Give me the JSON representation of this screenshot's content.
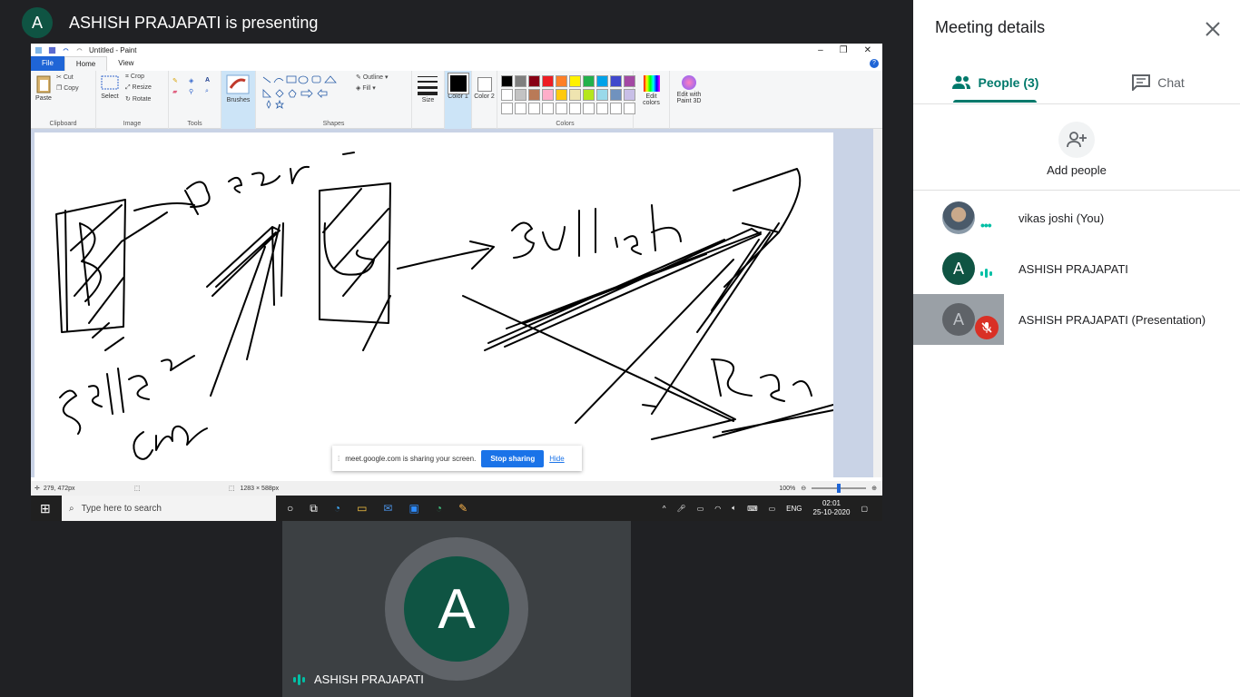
{
  "meeting": {
    "presenter_initial": "A",
    "presenter_banner": "ASHISH PRAJAPATI is presenting"
  },
  "paint": {
    "window_title": "Untitled - Paint",
    "tabs": [
      "File",
      "Home",
      "View"
    ],
    "clipboard": {
      "paste": "Paste",
      "cut": "Cut",
      "copy": "Copy",
      "group": "Clipboard"
    },
    "image": {
      "select": "Select",
      "crop": "Crop",
      "resize": "Resize",
      "rotate": "Rotate",
      "group": "Image"
    },
    "tools_group": "Tools",
    "brushes": "Brushes",
    "shapes": {
      "outline": "Outline",
      "fill": "Fill",
      "group": "Shapes"
    },
    "size": "Size",
    "color1": "Color 1",
    "color2": "Color 2",
    "colors_group": "Colors",
    "edit_colors": "Edit colors",
    "edit_3d": "Edit with Paint 3D",
    "palette_row1": [
      "#000000",
      "#7f7f7f",
      "#880015",
      "#ed1c24",
      "#ff7f27",
      "#fff200",
      "#22b14c",
      "#00a2e8",
      "#3f48cc",
      "#a349a4"
    ],
    "palette_row2": [
      "#ffffff",
      "#c3c3c3",
      "#b97a57",
      "#ffaec9",
      "#ffc90e",
      "#efe4b0",
      "#b5e61d",
      "#99d9ea",
      "#7092be",
      "#c8bfe7"
    ],
    "status": {
      "cursor": "279, 472px",
      "canvas_size": "1283 × 588px",
      "zoom": "100%"
    }
  },
  "share_notice": {
    "text": "meet.google.com is sharing your screen.",
    "stop": "Stop sharing",
    "hide": "Hide"
  },
  "taskbar": {
    "search_placeholder": "Type here to search",
    "lang": "ENG",
    "time": "02:01",
    "date": "25-10-2020"
  },
  "tile": {
    "initial": "A",
    "name": "ASHISH PRAJAPATI"
  },
  "panel": {
    "title": "Meeting details",
    "tab_people": "People (3)",
    "tab_chat": "Chat",
    "add_people": "Add people",
    "participants": [
      {
        "name": "vikas joshi (You)",
        "initial": ""
      },
      {
        "name": "ASHISH PRAJAPATI",
        "initial": "A"
      },
      {
        "name": "ASHISH PRAJAPATI (Presentation)",
        "initial": "A"
      }
    ]
  }
}
